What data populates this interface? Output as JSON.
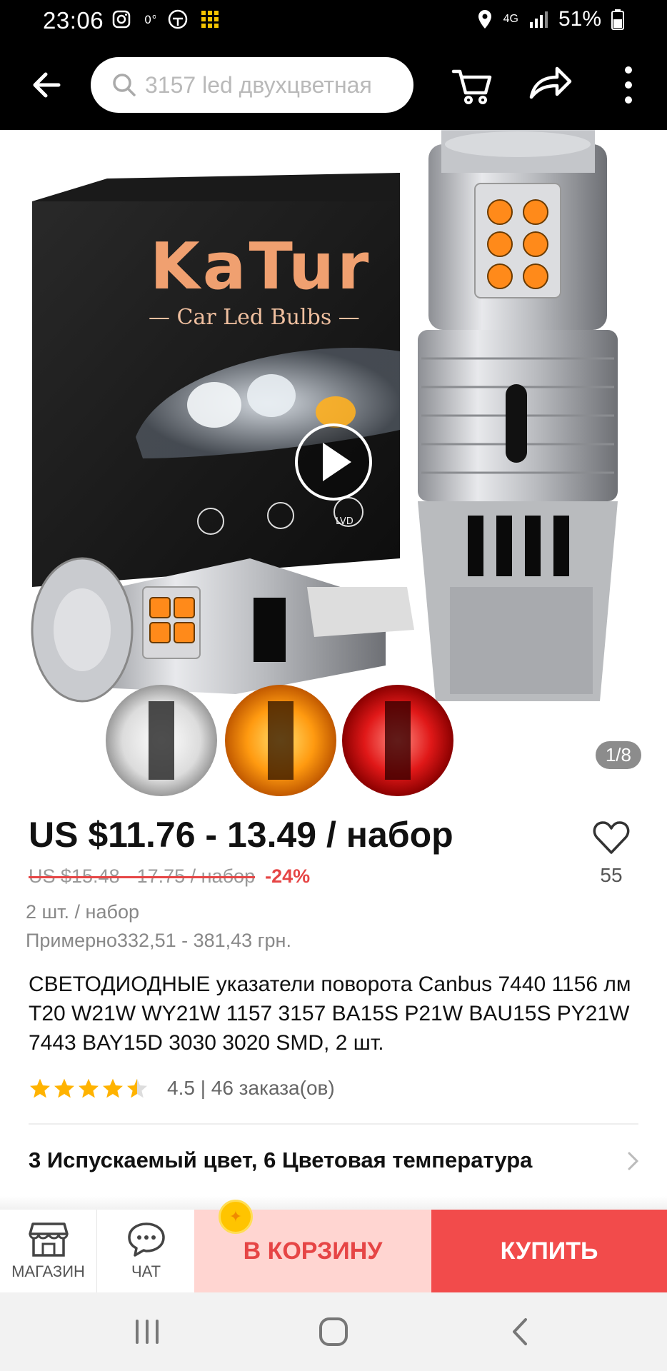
{
  "status_bar": {
    "time": "23:06",
    "battery": "51%",
    "network": "4G"
  },
  "search": {
    "placeholder": "3157 led двухцветная"
  },
  "gallery": {
    "counter": "1/8",
    "brand": "KaTur",
    "brand_sub": "— Car Led Bulbs —",
    "badge": "LVD"
  },
  "product": {
    "price": "US $11.76 - 13.49 / набор",
    "old_price": "US $15.48 - 17.75 / набор",
    "discount": "-24%",
    "wish_count": "55",
    "pack": "2 шт. / набор",
    "approx": "Примерно332,51 - 381,43 грн.",
    "title": "СВЕТОДИОДНЫЕ указатели поворота Canbus 7440 1156 лм T20 W21W WY21W 1157 3157 BA15S P21W BAU15S PY21W 7443 BAY15D 3030 3020 SMD, 2 шт.",
    "rating_text": "4.5 | 46 заказа(ов)",
    "rating_value": 4.5
  },
  "properties": {
    "label": "3 Испускаемый цвет, 6 Цветовая температура"
  },
  "action_bar": {
    "store_label": "МАГАЗИН",
    "chat_label": "ЧАТ",
    "cart_button": "В КОРЗИНУ",
    "buy_button": "КУПИТЬ"
  },
  "colors": {
    "accent_red": "#f24b4b",
    "cart_bg": "#ffd5d1",
    "star": "#ffb300"
  }
}
